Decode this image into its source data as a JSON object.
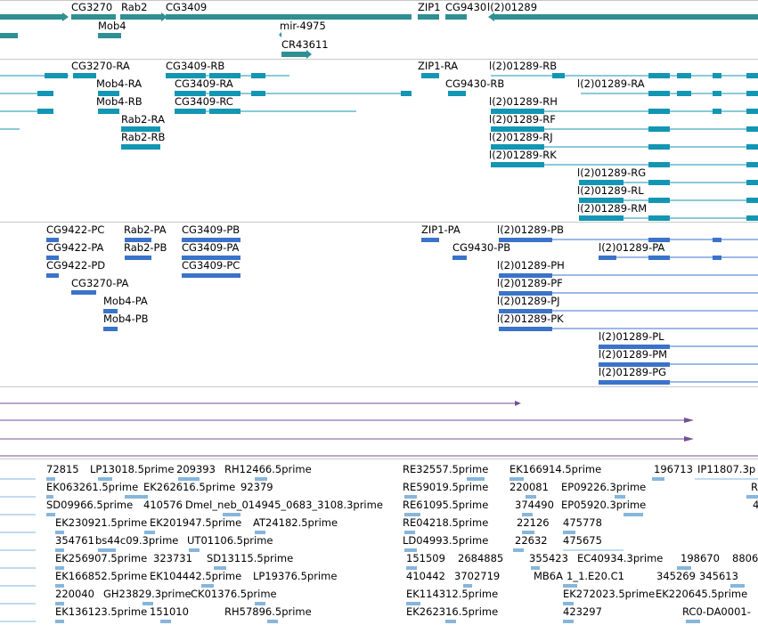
{
  "colors": {
    "gene": "#2f8f93",
    "transcript": "#1396b3",
    "cds": "#3a73c9",
    "alignment": "#73519a",
    "est": "#86b6dc",
    "divider": "#c0c0c0",
    "label": "#000000"
  },
  "tracks": {
    "genes": {
      "labels": [
        "CG3270",
        "Rab2",
        "CG3409",
        "ZIP1",
        "CG9430",
        "l(2)01289",
        "Mob4",
        "mir-4975",
        "CR43611"
      ]
    },
    "transcripts": {
      "labels": [
        "CG3270-RA",
        "CG3409-RB",
        "ZIP1-RA",
        "l(2)01289-RB",
        "Mob4-RA",
        "CG3409-RA",
        "CG9430-RB",
        "l(2)01289-RA",
        "Mob4-RB",
        "CG3409-RC",
        "l(2)01289-RH",
        "Rab2-RA",
        "l(2)01289-RF",
        "Rab2-RB",
        "l(2)01289-RJ",
        "l(2)01289-RK",
        "l(2)01289-RG",
        "l(2)01289-RL",
        "l(2)01289-RM"
      ]
    },
    "proteins": {
      "labels": [
        "CG9422-PC",
        "Rab2-PA",
        "CG3409-PB",
        "ZIP1-PA",
        "l(2)01289-PB",
        "CG9422-PA",
        "Rab2-PB",
        "CG3409-PA",
        "CG9430-PB",
        "l(2)01289-PA",
        "CG9422-PD",
        "CG3409-PC",
        "l(2)01289-PH",
        "CG3270-PA",
        "l(2)01289-PF",
        "Mob4-PA",
        "l(2)01289-PJ",
        "Mob4-PB",
        "l(2)01289-PK",
        "l(2)01289-PL",
        "l(2)01289-PM",
        "l(2)01289-PG"
      ]
    },
    "ests": {
      "labels": [
        "72815",
        "LP13018.5prime",
        "209393",
        "RH12466.5prime",
        "RE32557.5prime",
        "EK166914.5prime",
        "196713",
        "IP11807.3p",
        "EK063261.5prime",
        "EK262616.5prime",
        "92379",
        "RE59019.5prime",
        "220081",
        "EP09226.3prime",
        "R",
        "SD09966.5prime",
        "410576",
        "Dmel_neb_014945_0683_3108.3prime",
        "RE61095.5prime",
        "374490",
        "EP05920.3prime",
        "4",
        "EK230921.5prime",
        "EK201947.5prime",
        "AT24182.5prime",
        "RE04218.5prime",
        "22126",
        "475778",
        "354761",
        "bs44c09.3prime",
        "UT01106.5prime",
        "LD04993.5prime",
        "22632",
        "475675",
        "EK256907.5prime",
        "323731",
        "SD13115.5prime",
        "151509",
        "2684885",
        "355423",
        "EC40934.3prime",
        "198670",
        "8806",
        "EK166852.5prime",
        "EK104442.5prime",
        "LP19376.5prime",
        "410442",
        "3702719",
        "MB6A",
        "1_1.E20.C1",
        "345269",
        "345613",
        "220040",
        "GH23829.3prime",
        "CK01376.5prime",
        "EK114312.5prime",
        "EK272023.5prime",
        "EK220645.5prime",
        "EK136123.5prime",
        "151010",
        "RH57896.5prime",
        "EK262316.5prime",
        "423297",
        "RC0-DA0001-"
      ]
    }
  }
}
